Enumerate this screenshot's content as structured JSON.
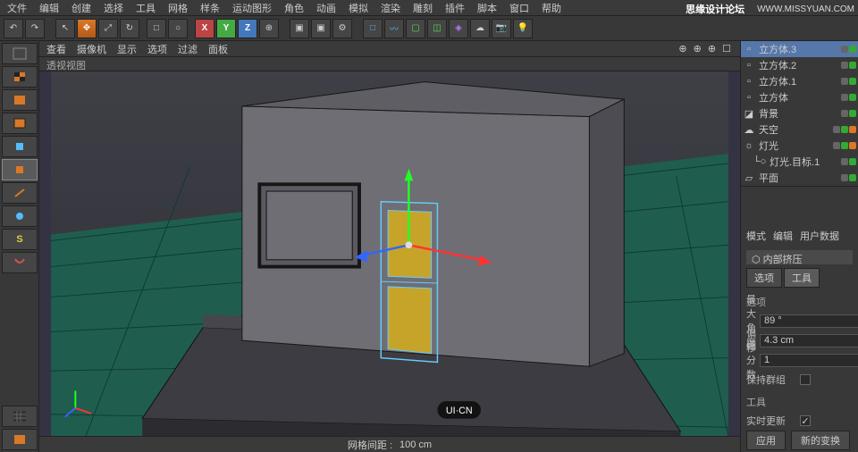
{
  "watermark": {
    "text": "思缘设计论坛",
    "url": "WWW.MISSYUAN.COM"
  },
  "menu": {
    "items": [
      "文件",
      "编辑",
      "创建",
      "选择",
      "工具",
      "网格",
      "样条",
      "运动图形",
      "角色",
      "动画",
      "模拟",
      "渲染",
      "雕刻",
      "插件",
      "脚本",
      "窗口",
      "帮助"
    ]
  },
  "toolbar_top": {
    "undo": "↶",
    "redo": "↷",
    "select": "↖",
    "move": "✥",
    "scale": "⤢",
    "rotate": "↻",
    "lastmod": "□",
    "lock": "○",
    "axis_x": "X",
    "axis_y": "Y",
    "axis_z": "Z",
    "world": "⊕",
    "render": "▣",
    "render_region": "▣",
    "render_settings": "⚙",
    "prim": "□",
    "spline": "〰",
    "nurbs": "▢",
    "gen": "◫",
    "deform": "◈",
    "env": "☁",
    "cam": "📷",
    "light": "💡"
  },
  "toolbar_left": {
    "live": "▣",
    "move": "✥",
    "scale": "⤢",
    "rotate": "↻",
    "recent": "◫",
    "poly": "▦",
    "obj": "□",
    "edge": "┗",
    "point": "●",
    "axis": "S",
    "snap": "◎",
    "work": "▦",
    "uv": "▦"
  },
  "viewport": {
    "menu": [
      "查看",
      "摄像机",
      "显示",
      "选项",
      "过滤",
      "面板"
    ],
    "title": "透视视图",
    "footer_label": "网格间距 :",
    "footer_value": "100 cm",
    "logo": "UI·CN"
  },
  "objects": {
    "items": [
      {
        "name": "立方体.3",
        "icon": "cube",
        "sel": true
      },
      {
        "name": "立方体.2",
        "icon": "cube"
      },
      {
        "name": "立方体.1",
        "icon": "cube"
      },
      {
        "name": "立方体",
        "icon": "cube"
      },
      {
        "name": "背景",
        "icon": "bg"
      },
      {
        "name": "天空",
        "icon": "sky"
      },
      {
        "name": "灯光",
        "icon": "light",
        "hasTarget": true
      },
      {
        "name": "灯光.目标.1",
        "icon": "null",
        "indent": true
      },
      {
        "name": "平面",
        "icon": "plane"
      }
    ]
  },
  "attributes": {
    "tabs": [
      "模式",
      "编辑",
      "用户数据"
    ],
    "tool_name": "内部挤压",
    "subtabs": [
      "选项",
      "工具"
    ],
    "section_options": "选项",
    "max_angle_label": "最大角度",
    "max_angle_value": "89 °",
    "offset_label": "偏移",
    "offset_value": "4.3 cm",
    "subdiv_label": "细分数",
    "subdiv_value": "1",
    "preserve_label": "保持群组",
    "section_tool": "工具",
    "realtime_label": "实时更新",
    "apply": "应用",
    "new_transform": "新的变换"
  }
}
